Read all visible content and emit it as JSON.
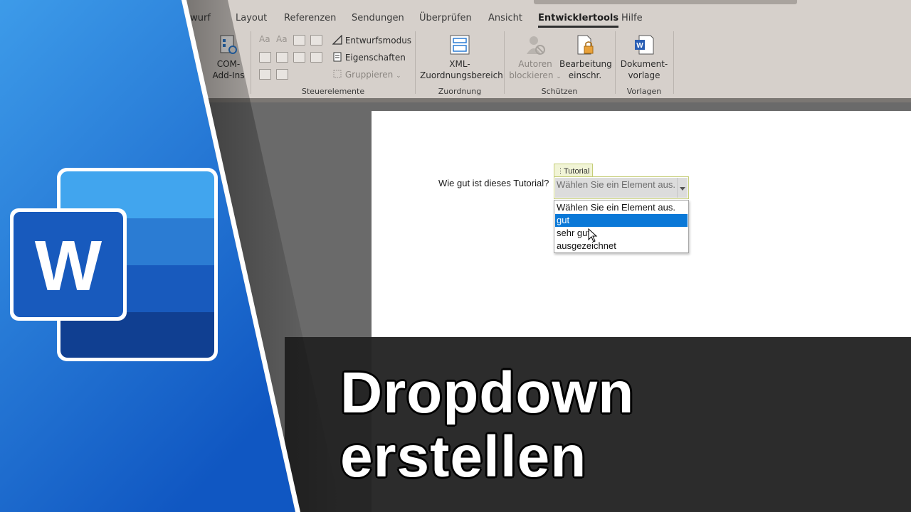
{
  "ribbon": {
    "tabs": [
      {
        "label": "twurf"
      },
      {
        "label": "Layout"
      },
      {
        "label": "Referenzen"
      },
      {
        "label": "Sendungen"
      },
      {
        "label": "Überprüfen"
      },
      {
        "label": "Ansicht"
      },
      {
        "label": "Entwicklertools",
        "active": true
      },
      {
        "label": "Hilfe"
      }
    ],
    "com_addins": {
      "line1": "COM-",
      "line2": "Add-Ins"
    },
    "controls": {
      "design_mode": "Entwurfsmodus",
      "properties": "Eigenschaften",
      "group": "Gruppieren"
    },
    "groups": {
      "controls_label": "Steuerelemente",
      "mapping_label": "Zuordnung",
      "protect_label": "Schützen",
      "templates_label": "Vorlagen"
    },
    "xml": {
      "line1": "XML-",
      "line2": "Zuordnungsbereich"
    },
    "block_authors": {
      "line1": "Autoren",
      "line2": "blockieren"
    },
    "restrict_editing": {
      "line1": "Bearbeitung",
      "line2": "einschr."
    },
    "document_template": {
      "line1": "Dokument-",
      "line2": "vorlage"
    }
  },
  "document": {
    "question": "Wie gut ist dieses Tutorial?",
    "control_tag": "Tutorial",
    "control_placeholder": "Wählen Sie ein Element aus.",
    "options": [
      {
        "label": "Wählen Sie ein Element aus.",
        "selected": false
      },
      {
        "label": "gut",
        "selected": true
      },
      {
        "label": "sehr gut",
        "selected": false
      },
      {
        "label": "ausgezeichnet",
        "selected": false
      }
    ]
  },
  "overlay": {
    "logo_letter": "W",
    "title_line1": "Dropdown",
    "title_line2": "erstellen"
  },
  "colors": {
    "accent_blue": "#1e6fd1",
    "selection_blue": "#0a78d7",
    "word_dark_blue": "#185abd",
    "ribbon_bg": "#d6d0cb"
  }
}
